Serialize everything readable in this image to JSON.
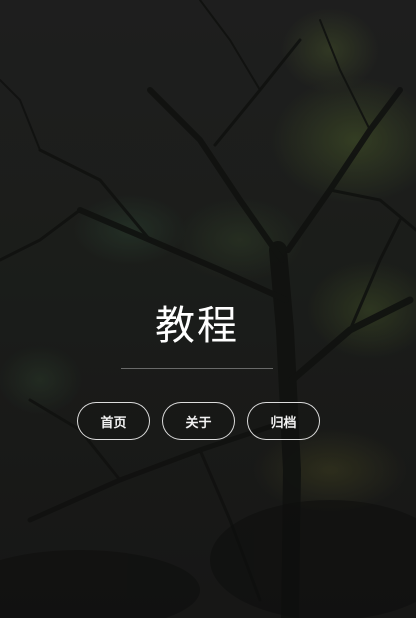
{
  "page": {
    "title": "教程"
  },
  "nav": {
    "items": [
      {
        "label": "首页"
      },
      {
        "label": "关于"
      },
      {
        "label": "归档"
      }
    ]
  },
  "colors": {
    "text": "#ffffff",
    "background": "#1c1c1c",
    "foliage": "#586e30"
  }
}
